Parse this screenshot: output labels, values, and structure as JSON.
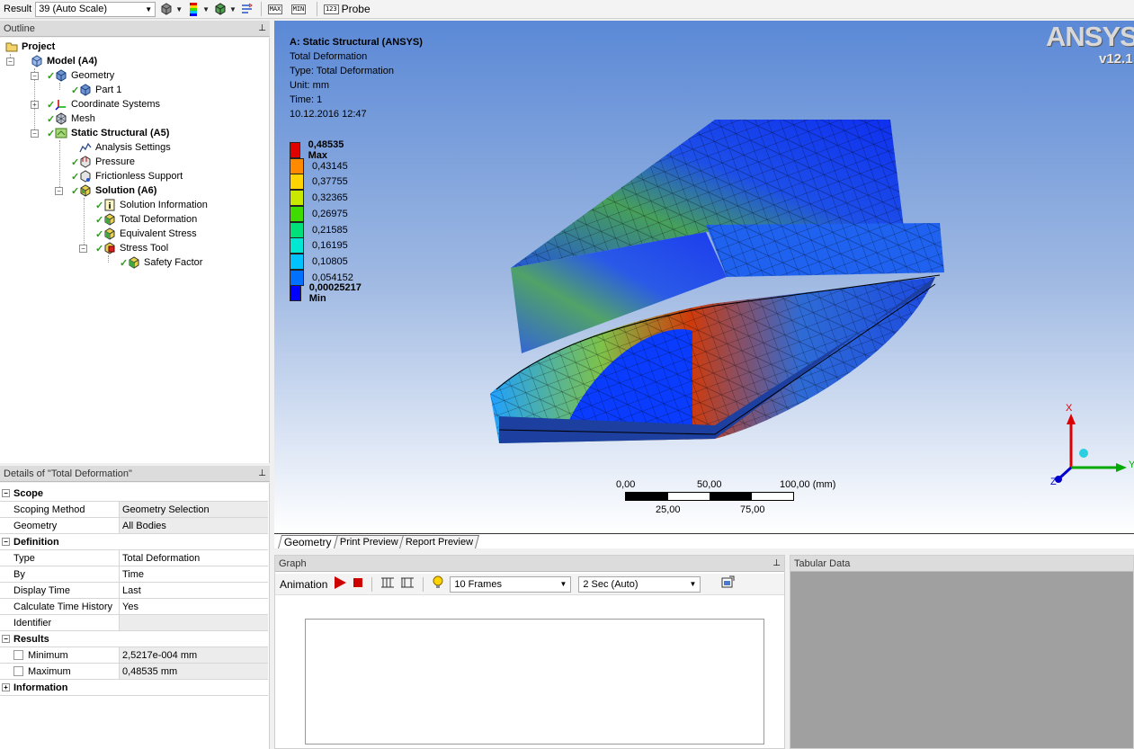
{
  "toolbar": {
    "result_label": "Result",
    "scale_value": "39 (Auto Scale)",
    "probe_label": "Probe",
    "max_badge": "MAX",
    "min_badge": "MIN",
    "probe_badge": "123"
  },
  "outline": {
    "title": "Outline",
    "items": [
      {
        "label": "Project"
      },
      {
        "label": "Model (A4)"
      },
      {
        "label": "Geometry"
      },
      {
        "label": "Part 1"
      },
      {
        "label": "Coordinate Systems"
      },
      {
        "label": "Mesh"
      },
      {
        "label": "Static Structural (A5)"
      },
      {
        "label": "Analysis Settings"
      },
      {
        "label": "Pressure"
      },
      {
        "label": "Frictionless Support"
      },
      {
        "label": "Solution (A6)"
      },
      {
        "label": "Solution Information"
      },
      {
        "label": "Total Deformation"
      },
      {
        "label": "Equivalent Stress"
      },
      {
        "label": "Stress Tool"
      },
      {
        "label": "Safety Factor"
      }
    ]
  },
  "details": {
    "title": "Details of \"Total Deformation\"",
    "groups": {
      "scope": "Scope",
      "definition": "Definition",
      "results": "Results",
      "information": "Information"
    },
    "rows": {
      "scoping_method": {
        "key": "Scoping Method",
        "value": "Geometry Selection"
      },
      "geometry": {
        "key": "Geometry",
        "value": "All Bodies"
      },
      "type": {
        "key": "Type",
        "value": "Total Deformation"
      },
      "by": {
        "key": "By",
        "value": "Time"
      },
      "display_time": {
        "key": "Display Time",
        "value": "Last"
      },
      "calc_history": {
        "key": "Calculate Time History",
        "value": "Yes"
      },
      "identifier": {
        "key": "Identifier",
        "value": ""
      },
      "minimum": {
        "key": "Minimum",
        "value": "2,5217e-004 mm"
      },
      "maximum": {
        "key": "Maximum",
        "value": "0,48535 mm"
      }
    }
  },
  "viewport": {
    "title": "A: Static Structural (ANSYS)",
    "result": "Total Deformation",
    "type": "Type: Total Deformation",
    "unit": "Unit: mm",
    "time": "Time: 1",
    "date": "10.12.2016 12:47",
    "logo": "ANSYS",
    "version": "v12.1",
    "legend": [
      {
        "label": "0,48535 Max",
        "color": "#e00000"
      },
      {
        "label": "0,43145",
        "color": "#ff8a00"
      },
      {
        "label": "0,37755",
        "color": "#ffd400"
      },
      {
        "label": "0,32365",
        "color": "#c8e800"
      },
      {
        "label": "0,26975",
        "color": "#3fdc00"
      },
      {
        "label": "0,21585",
        "color": "#00e07a"
      },
      {
        "label": "0,16195",
        "color": "#00e8d4"
      },
      {
        "label": "0,10805",
        "color": "#00c2ff"
      },
      {
        "label": "0,054152",
        "color": "#0070ff"
      },
      {
        "label": "0,00025217 Min",
        "color": "#0000ff"
      }
    ],
    "scale": {
      "t0": "0,00",
      "t50": "50,00",
      "t100": "100,00 (mm)",
      "t25": "25,00",
      "t75": "75,00"
    },
    "axes": {
      "x": "X",
      "y": "Y",
      "z": "Z"
    }
  },
  "tabs": [
    "Geometry",
    "Print Preview",
    "Report Preview"
  ],
  "graph": {
    "title": "Graph",
    "animation_label": "Animation",
    "frames": "10 Frames",
    "duration": "2 Sec (Auto)"
  },
  "tabular": {
    "title": "Tabular Data"
  }
}
